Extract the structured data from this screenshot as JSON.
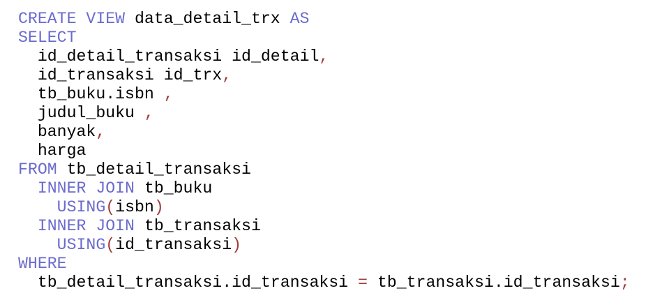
{
  "lines": [
    [
      {
        "t": "CREATE VIEW",
        "c": "kw"
      },
      {
        "t": " data_detail_trx ",
        "c": "id"
      },
      {
        "t": "AS",
        "c": "kw"
      }
    ],
    [
      {
        "t": "SELECT",
        "c": "kw"
      }
    ],
    [
      {
        "t": "  id_detail_transaksi id_detail",
        "c": "id"
      },
      {
        "t": ",",
        "c": "pn"
      }
    ],
    [
      {
        "t": "  id_transaksi id_trx",
        "c": "id"
      },
      {
        "t": ",",
        "c": "pn"
      }
    ],
    [
      {
        "t": "  tb_buku.isbn ",
        "c": "id"
      },
      {
        "t": ",",
        "c": "pn"
      }
    ],
    [
      {
        "t": "  judul_buku ",
        "c": "id"
      },
      {
        "t": ",",
        "c": "pn"
      }
    ],
    [
      {
        "t": "  banyak",
        "c": "id"
      },
      {
        "t": ",",
        "c": "pn"
      }
    ],
    [
      {
        "t": "  harga",
        "c": "id"
      }
    ],
    [
      {
        "t": "FROM",
        "c": "kw"
      },
      {
        "t": " tb_detail_transaksi",
        "c": "id"
      }
    ],
    [
      {
        "t": "  INNER JOIN",
        "c": "kw"
      },
      {
        "t": " tb_buku",
        "c": "id"
      }
    ],
    [
      {
        "t": "    USING",
        "c": "kw"
      },
      {
        "t": "(",
        "c": "pn"
      },
      {
        "t": "isbn",
        "c": "id"
      },
      {
        "t": ")",
        "c": "pn"
      }
    ],
    [
      {
        "t": "  INNER JOIN",
        "c": "kw"
      },
      {
        "t": " tb_transaksi",
        "c": "id"
      }
    ],
    [
      {
        "t": "    USING",
        "c": "kw"
      },
      {
        "t": "(",
        "c": "pn"
      },
      {
        "t": "id_transaksi",
        "c": "id"
      },
      {
        "t": ")",
        "c": "pn"
      }
    ],
    [
      {
        "t": "WHERE",
        "c": "kw"
      }
    ],
    [
      {
        "t": "  tb_detail_transaksi.id_transaksi ",
        "c": "id"
      },
      {
        "t": "=",
        "c": "pn"
      },
      {
        "t": " tb_transaksi.id_transaksi",
        "c": "id"
      },
      {
        "t": ";",
        "c": "pn"
      }
    ]
  ],
  "colors": {
    "keyword": "#6b6bcf",
    "punctuation": "#a33b3b",
    "identifier": "#000000",
    "background": "#ffffff"
  }
}
